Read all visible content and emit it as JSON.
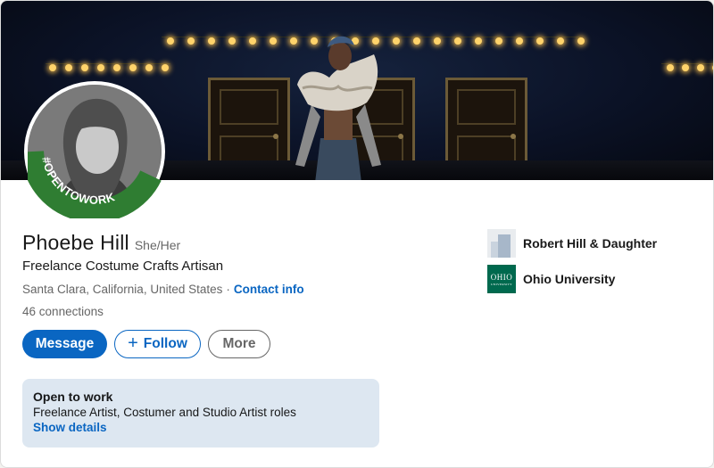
{
  "profile": {
    "name": "Phoebe Hill",
    "pronouns": "She/Her",
    "headline": "Freelance Costume Crafts Artisan",
    "location": "Santa Clara, California, United States",
    "separator": "·",
    "contact_info_label": "Contact info",
    "connections_count": "46",
    "connections_label": "connections",
    "open_to_work_badge": "#OPENTOWORK"
  },
  "actions": {
    "message_label": "Message",
    "follow_label": "Follow",
    "follow_icon": "+",
    "more_label": "More"
  },
  "open_to_work": {
    "title": "Open to work",
    "roles": "Freelance Artist, Costumer and Studio Artist roles",
    "details_link": "Show details"
  },
  "organizations": [
    {
      "name": "Robert Hill & Daughter",
      "logo": "building-logo"
    },
    {
      "name": "Ohio University",
      "logo_text": "OHIO",
      "logo_subtext": "UNIVERSITY"
    }
  ],
  "colors": {
    "primary": "#0a66c2",
    "open_to_work_green": "#2f7d32",
    "otw_box_bg": "#dde7f1",
    "ohio_green": "#00694e"
  }
}
